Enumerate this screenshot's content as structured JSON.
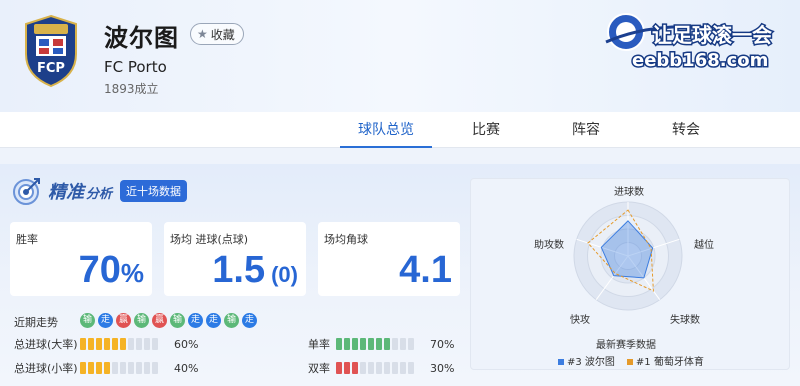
{
  "team": {
    "name": "波尔图",
    "name_en": "FC Porto",
    "founded": "1893成立",
    "favorite_label": "收藏",
    "crest_text": "FCP"
  },
  "brand": {
    "text": "让足球滚一会",
    "site": "eebb168.com"
  },
  "tabs": [
    "球队总览",
    "比赛",
    "阵容",
    "转会"
  ],
  "active_tab": 0,
  "analysis": {
    "title": "精准",
    "title_small": "分析",
    "badge": "近十场数据",
    "cards": [
      {
        "label": "胜率",
        "value": "70",
        "unit": "%"
      },
      {
        "label": "场均 进球(点球)",
        "value": "1.5",
        "paren": "(0)"
      },
      {
        "label": "场均角球",
        "value": "4.1"
      }
    ],
    "trend_label": "近期走势",
    "trend": [
      "输",
      "走",
      "赢",
      "输",
      "赢",
      "输",
      "走",
      "走",
      "输",
      "走"
    ],
    "meters": [
      {
        "label": "总进球(大率)",
        "percent": "60%",
        "level": 0.6,
        "color": "yellow"
      },
      {
        "label": "总进球(小率)",
        "percent": "40%",
        "level": 0.4,
        "color": "yellow"
      },
      {
        "label": "单率",
        "percent": "70%",
        "level": 0.7,
        "color": "green"
      },
      {
        "label": "双率",
        "percent": "30%",
        "level": 0.3,
        "color": "red"
      }
    ]
  },
  "radar": {
    "axes": [
      "进球数",
      "越位",
      "失球数",
      "快攻",
      "助攻数"
    ],
    "caption": "最新赛季数据",
    "series": [
      {
        "name": "#3 波尔图",
        "color": "#3c7de0",
        "values": [
          0.65,
          0.48,
          0.5,
          0.45,
          0.52
        ]
      },
      {
        "name": "#1 葡萄牙体育",
        "color": "#e59a2a",
        "values": [
          0.85,
          0.45,
          0.8,
          0.4,
          0.78
        ]
      }
    ]
  }
}
